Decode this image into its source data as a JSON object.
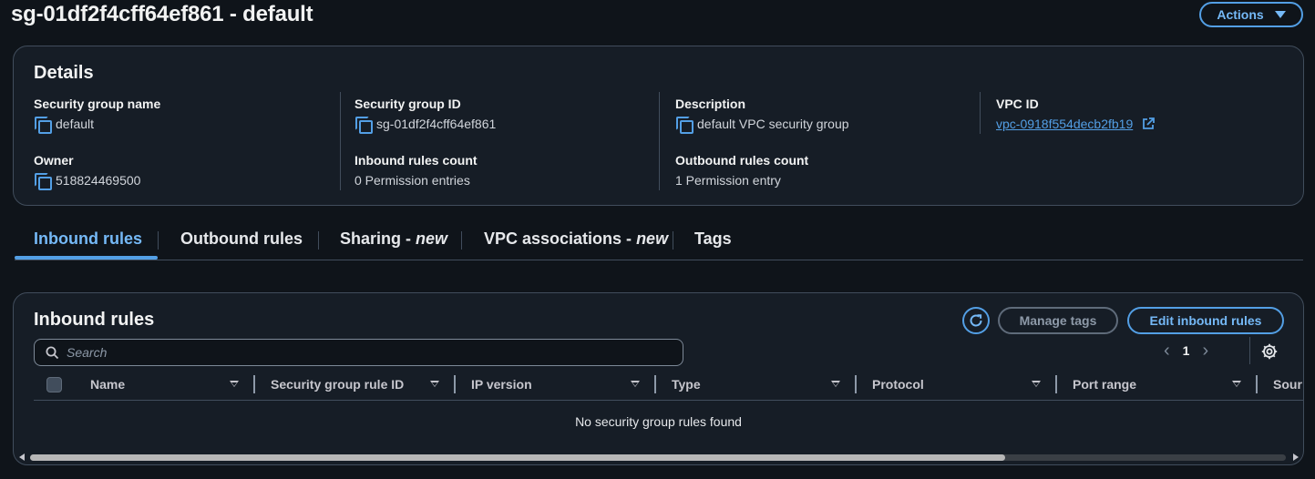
{
  "header": {
    "title": "sg-01df2f4cff64ef861 - default",
    "actions_label": "Actions"
  },
  "details": {
    "title": "Details",
    "fields": [
      {
        "label": "Security group name",
        "value": "default",
        "copyable": true
      },
      {
        "label": "Security group ID",
        "value": "sg-01df2f4cff64ef861",
        "copyable": true
      },
      {
        "label": "Description",
        "value": "default VPC security group",
        "copyable": true
      },
      {
        "label": "VPC ID",
        "value": "vpc-0918f554decb2fb19",
        "link": true
      },
      {
        "label": "Owner",
        "value": "518824469500",
        "copyable": true
      },
      {
        "label": "Inbound rules count",
        "value": "0 Permission entries"
      },
      {
        "label": "Outbound rules count",
        "value": "1 Permission entry"
      }
    ]
  },
  "tabs": [
    {
      "label": "Inbound rules",
      "suffix": "",
      "active": true
    },
    {
      "label": "Outbound rules",
      "suffix": ""
    },
    {
      "label": "Sharing - ",
      "suffix": "new"
    },
    {
      "label": "VPC associations - ",
      "suffix": "new"
    },
    {
      "label": "Tags",
      "suffix": ""
    }
  ],
  "rules": {
    "title": "Inbound rules",
    "manage_tags_label": "Manage tags",
    "edit_label": "Edit inbound rules",
    "search_placeholder": "Search",
    "current_page": "1",
    "columns": [
      "Name",
      "Security group rule ID",
      "IP version",
      "Type",
      "Protocol",
      "Port range",
      "Sour"
    ],
    "empty_message": "No security group rules found"
  },
  "colors": {
    "background": "#0f141a",
    "panel": "#161d26",
    "accent": "#539fe5",
    "border": "#414d5c"
  },
  "icons": [
    "copy-icon",
    "external-link-icon",
    "refresh-icon",
    "search-icon",
    "chevron-left-icon",
    "chevron-right-icon",
    "settings-gear-icon",
    "sort-caret-icon"
  ]
}
